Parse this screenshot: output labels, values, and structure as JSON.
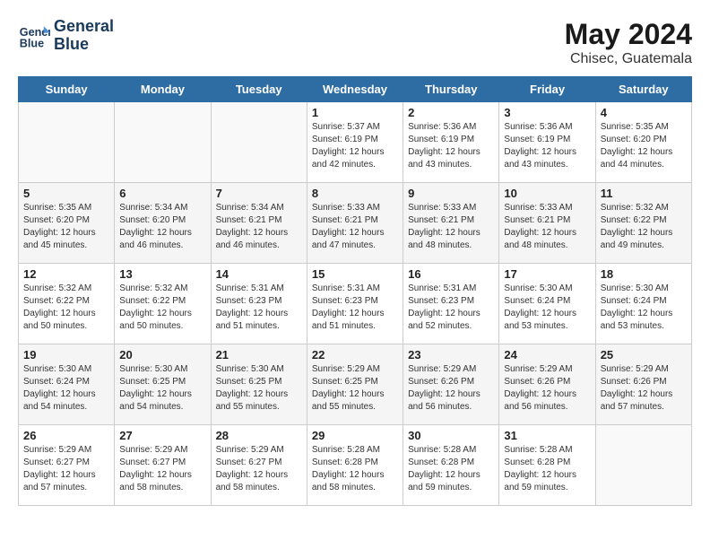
{
  "header": {
    "logo_line1": "General",
    "logo_line2": "Blue",
    "month_year": "May 2024",
    "location": "Chisec, Guatemala"
  },
  "days_of_week": [
    "Sunday",
    "Monday",
    "Tuesday",
    "Wednesday",
    "Thursday",
    "Friday",
    "Saturday"
  ],
  "weeks": [
    [
      {
        "day": "",
        "info": ""
      },
      {
        "day": "",
        "info": ""
      },
      {
        "day": "",
        "info": ""
      },
      {
        "day": "1",
        "info": "Sunrise: 5:37 AM\nSunset: 6:19 PM\nDaylight: 12 hours\nand 42 minutes."
      },
      {
        "day": "2",
        "info": "Sunrise: 5:36 AM\nSunset: 6:19 PM\nDaylight: 12 hours\nand 43 minutes."
      },
      {
        "day": "3",
        "info": "Sunrise: 5:36 AM\nSunset: 6:19 PM\nDaylight: 12 hours\nand 43 minutes."
      },
      {
        "day": "4",
        "info": "Sunrise: 5:35 AM\nSunset: 6:20 PM\nDaylight: 12 hours\nand 44 minutes."
      }
    ],
    [
      {
        "day": "5",
        "info": "Sunrise: 5:35 AM\nSunset: 6:20 PM\nDaylight: 12 hours\nand 45 minutes."
      },
      {
        "day": "6",
        "info": "Sunrise: 5:34 AM\nSunset: 6:20 PM\nDaylight: 12 hours\nand 46 minutes."
      },
      {
        "day": "7",
        "info": "Sunrise: 5:34 AM\nSunset: 6:21 PM\nDaylight: 12 hours\nand 46 minutes."
      },
      {
        "day": "8",
        "info": "Sunrise: 5:33 AM\nSunset: 6:21 PM\nDaylight: 12 hours\nand 47 minutes."
      },
      {
        "day": "9",
        "info": "Sunrise: 5:33 AM\nSunset: 6:21 PM\nDaylight: 12 hours\nand 48 minutes."
      },
      {
        "day": "10",
        "info": "Sunrise: 5:33 AM\nSunset: 6:21 PM\nDaylight: 12 hours\nand 48 minutes."
      },
      {
        "day": "11",
        "info": "Sunrise: 5:32 AM\nSunset: 6:22 PM\nDaylight: 12 hours\nand 49 minutes."
      }
    ],
    [
      {
        "day": "12",
        "info": "Sunrise: 5:32 AM\nSunset: 6:22 PM\nDaylight: 12 hours\nand 50 minutes."
      },
      {
        "day": "13",
        "info": "Sunrise: 5:32 AM\nSunset: 6:22 PM\nDaylight: 12 hours\nand 50 minutes."
      },
      {
        "day": "14",
        "info": "Sunrise: 5:31 AM\nSunset: 6:23 PM\nDaylight: 12 hours\nand 51 minutes."
      },
      {
        "day": "15",
        "info": "Sunrise: 5:31 AM\nSunset: 6:23 PM\nDaylight: 12 hours\nand 51 minutes."
      },
      {
        "day": "16",
        "info": "Sunrise: 5:31 AM\nSunset: 6:23 PM\nDaylight: 12 hours\nand 52 minutes."
      },
      {
        "day": "17",
        "info": "Sunrise: 5:30 AM\nSunset: 6:24 PM\nDaylight: 12 hours\nand 53 minutes."
      },
      {
        "day": "18",
        "info": "Sunrise: 5:30 AM\nSunset: 6:24 PM\nDaylight: 12 hours\nand 53 minutes."
      }
    ],
    [
      {
        "day": "19",
        "info": "Sunrise: 5:30 AM\nSunset: 6:24 PM\nDaylight: 12 hours\nand 54 minutes."
      },
      {
        "day": "20",
        "info": "Sunrise: 5:30 AM\nSunset: 6:25 PM\nDaylight: 12 hours\nand 54 minutes."
      },
      {
        "day": "21",
        "info": "Sunrise: 5:30 AM\nSunset: 6:25 PM\nDaylight: 12 hours\nand 55 minutes."
      },
      {
        "day": "22",
        "info": "Sunrise: 5:29 AM\nSunset: 6:25 PM\nDaylight: 12 hours\nand 55 minutes."
      },
      {
        "day": "23",
        "info": "Sunrise: 5:29 AM\nSunset: 6:26 PM\nDaylight: 12 hours\nand 56 minutes."
      },
      {
        "day": "24",
        "info": "Sunrise: 5:29 AM\nSunset: 6:26 PM\nDaylight: 12 hours\nand 56 minutes."
      },
      {
        "day": "25",
        "info": "Sunrise: 5:29 AM\nSunset: 6:26 PM\nDaylight: 12 hours\nand 57 minutes."
      }
    ],
    [
      {
        "day": "26",
        "info": "Sunrise: 5:29 AM\nSunset: 6:27 PM\nDaylight: 12 hours\nand 57 minutes."
      },
      {
        "day": "27",
        "info": "Sunrise: 5:29 AM\nSunset: 6:27 PM\nDaylight: 12 hours\nand 58 minutes."
      },
      {
        "day": "28",
        "info": "Sunrise: 5:29 AM\nSunset: 6:27 PM\nDaylight: 12 hours\nand 58 minutes."
      },
      {
        "day": "29",
        "info": "Sunrise: 5:28 AM\nSunset: 6:28 PM\nDaylight: 12 hours\nand 58 minutes."
      },
      {
        "day": "30",
        "info": "Sunrise: 5:28 AM\nSunset: 6:28 PM\nDaylight: 12 hours\nand 59 minutes."
      },
      {
        "day": "31",
        "info": "Sunrise: 5:28 AM\nSunset: 6:28 PM\nDaylight: 12 hours\nand 59 minutes."
      },
      {
        "day": "",
        "info": ""
      }
    ]
  ]
}
